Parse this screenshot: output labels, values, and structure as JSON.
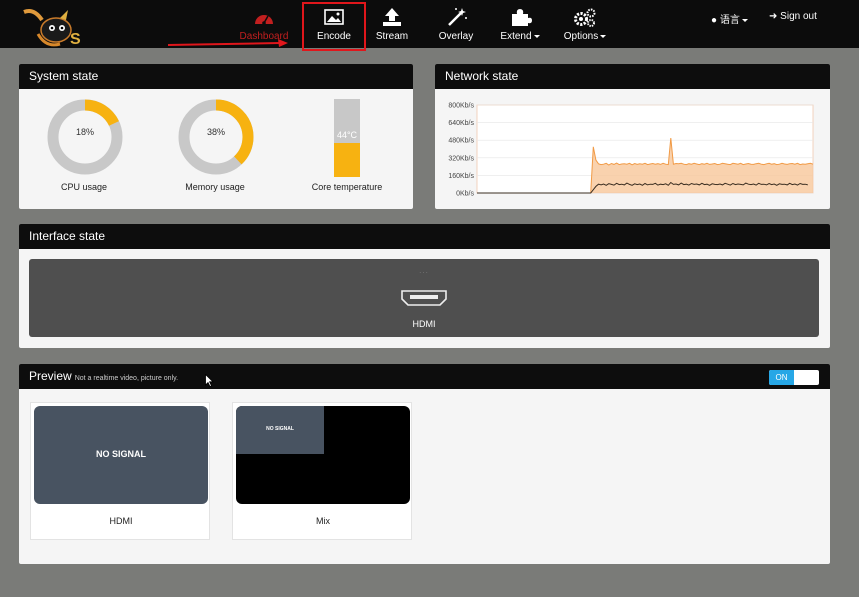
{
  "nav": {
    "items": [
      {
        "id": "dashboard",
        "label": "Dashboard",
        "icon": "speedometer-icon",
        "active": true
      },
      {
        "id": "encode",
        "label": "Encode",
        "icon": "image-icon"
      },
      {
        "id": "stream",
        "label": "Stream",
        "icon": "upload-icon"
      },
      {
        "id": "overlay",
        "label": "Overlay",
        "icon": "magic-wand-icon"
      },
      {
        "id": "extend",
        "label": "Extend",
        "icon": "puzzle-icon",
        "dropdown": true
      },
      {
        "id": "options",
        "label": "Options",
        "icon": "gears-icon",
        "dropdown": true
      }
    ],
    "language": "语言",
    "sign_out": "Sign out"
  },
  "system_state": {
    "title": "System state",
    "cpu": {
      "value": "18%",
      "label": "CPU usage",
      "fraction": 0.18
    },
    "memory": {
      "value": "38%",
      "label": "Memory usage",
      "fraction": 0.38
    },
    "core_temp": {
      "value": "44°C",
      "label": "Core temperature",
      "fraction": 0.44
    }
  },
  "network_state": {
    "title": "Network state"
  },
  "chart_data": {
    "type": "area",
    "title": "",
    "yticks": [
      "800Kb/s",
      "640Kb/s",
      "480Kb/s",
      "320Kb/s",
      "160Kb/s",
      "0Kb/s"
    ],
    "ylim": [
      0,
      800
    ],
    "grid": true,
    "series": [
      {
        "values": [
          0,
          0,
          0,
          0,
          0,
          0,
          0,
          0,
          0,
          0,
          0,
          0,
          0,
          0,
          0,
          0,
          0,
          0,
          0,
          0,
          0,
          0,
          0,
          0,
          0,
          0,
          0,
          0,
          0,
          0,
          0,
          0,
          0,
          0,
          0,
          0,
          0,
          0,
          0,
          0,
          0,
          0,
          0,
          0,
          0,
          420,
          300,
          265,
          258,
          262,
          270,
          255,
          268,
          260,
          272,
          258,
          264,
          266,
          262,
          270,
          256,
          268,
          260,
          265,
          262,
          270,
          258,
          264,
          268,
          262,
          266,
          260,
          270,
          262,
          258,
          500,
          262,
          268,
          265,
          270,
          262,
          258,
          266,
          262,
          270,
          264,
          258,
          266,
          262,
          270,
          260,
          264,
          268,
          258,
          262,
          270,
          266,
          262,
          258,
          270,
          266,
          262,
          270,
          258,
          264,
          268,
          262,
          260,
          266,
          270,
          262,
          258,
          265,
          270,
          262,
          266,
          258,
          262,
          270,
          264,
          260,
          266,
          268,
          262,
          270,
          258,
          264,
          262,
          266,
          270,
          262
        ]
      },
      {
        "values": [
          0,
          0,
          0,
          0,
          0,
          0,
          0,
          0,
          0,
          0,
          0,
          0,
          0,
          0,
          0,
          0,
          0,
          0,
          0,
          0,
          0,
          0,
          0,
          0,
          0,
          0,
          0,
          0,
          0,
          0,
          0,
          0,
          0,
          0,
          0,
          0,
          0,
          0,
          0,
          0,
          0,
          0,
          0,
          0,
          0,
          30,
          60,
          80,
          75,
          82,
          70,
          85,
          78,
          72,
          88,
          76,
          80,
          74,
          90,
          78,
          70,
          84,
          76,
          82,
          70,
          86,
          74,
          80,
          78,
          88,
          72,
          80,
          76,
          84,
          70,
          95,
          78,
          82,
          74,
          90,
          76,
          80,
          72,
          86,
          78,
          82,
          74,
          88,
          76,
          80,
          70,
          84,
          78,
          76,
          82,
          74,
          88,
          80,
          72,
          86,
          76,
          82,
          78,
          74,
          90,
          80,
          76,
          82,
          72,
          88,
          78,
          80,
          74,
          86,
          76,
          82,
          70,
          84,
          78,
          80,
          74,
          88,
          76,
          82,
          72,
          86,
          78,
          80,
          74
        ]
      }
    ],
    "colors": {
      "area": "#f8c79a",
      "line": "#f19a45",
      "line2": "#3a2d20"
    }
  },
  "interface_state": {
    "title": "Interface state",
    "dots": "...",
    "hdmi_label": "HDMI"
  },
  "preview": {
    "title": "Preview",
    "subtitle": "Not a realtime video, picture only.",
    "toggle": "ON",
    "cards": [
      {
        "label": "HDMI",
        "screen_text": "NO SIGNAL"
      },
      {
        "label": "Mix",
        "screen_text": "NO SIGNAL"
      }
    ]
  },
  "colors": {
    "accent_red": "#c21f1f",
    "highlight": "#e0161b",
    "gauge_fill": "#f7b211",
    "gauge_track": "#c8c8c8",
    "toggle_on": "#27a7e6"
  }
}
